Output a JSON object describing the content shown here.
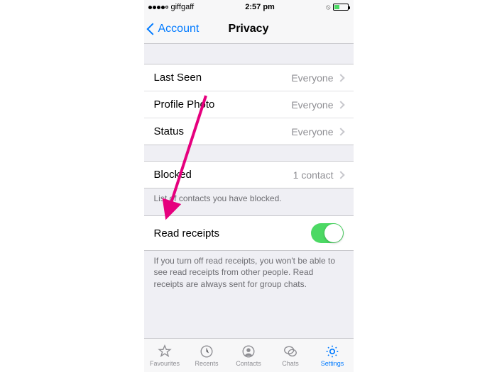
{
  "statusbar": {
    "carrier": "giffgaff",
    "time": "2:57 pm"
  },
  "navbar": {
    "back_label": "Account",
    "title": "Privacy"
  },
  "privacy_rows": [
    {
      "label": "Last Seen",
      "value": "Everyone"
    },
    {
      "label": "Profile Photo",
      "value": "Everyone"
    },
    {
      "label": "Status",
      "value": "Everyone"
    }
  ],
  "blocked": {
    "label": "Blocked",
    "value": "1 contact",
    "footer": "List of contacts you have blocked."
  },
  "read_receipts": {
    "label": "Read receipts",
    "enabled": true,
    "footer": "If you turn off read receipts, you won't be able to see read receipts from other people. Read receipts are always sent for group chats."
  },
  "tabs": [
    {
      "label": "Favourites"
    },
    {
      "label": "Recents"
    },
    {
      "label": "Contacts"
    },
    {
      "label": "Chats"
    },
    {
      "label": "Settings"
    }
  ],
  "colors": {
    "tint": "#007aff",
    "toggle_on": "#4cd964",
    "arrow": "#e6007e"
  }
}
